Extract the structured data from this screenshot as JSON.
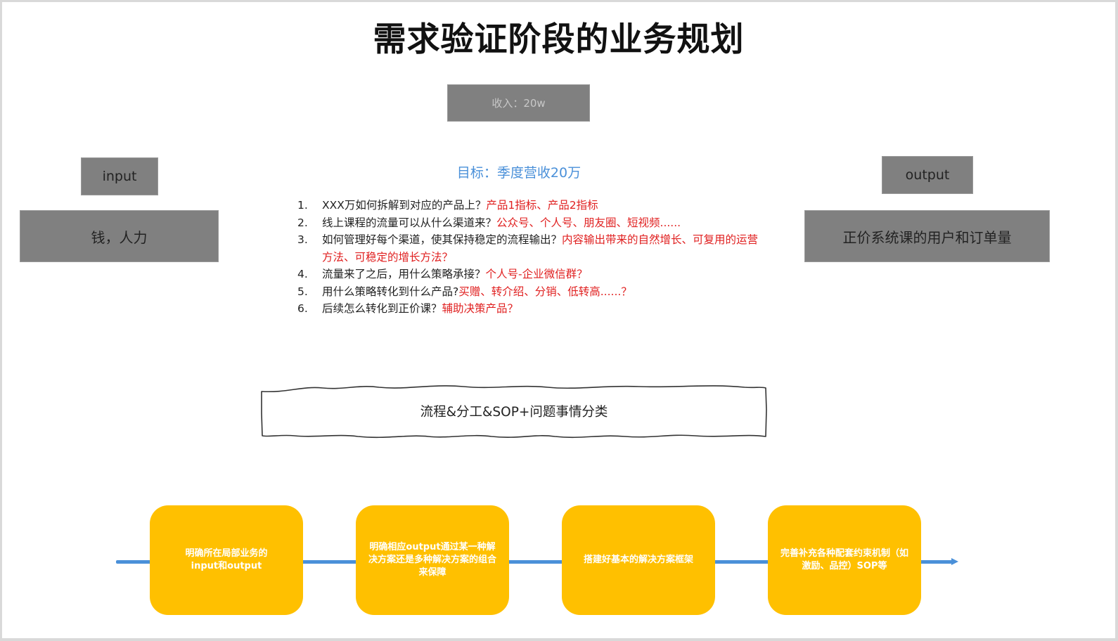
{
  "title": "需求验证阶段的业务规划",
  "revenue_box": "收入：20w",
  "input": {
    "label": "input",
    "value": "钱，人力"
  },
  "output": {
    "label": "output",
    "value": "正价系统课的用户和订单量"
  },
  "goal": "目标：季度营收20万",
  "questions": [
    {
      "num": "1.",
      "text": "XXX万如何拆解到对应的产品上？",
      "answer": "产品1指标、产品2指标"
    },
    {
      "num": "2.",
      "text": "线上课程的流量可以从什么渠道来？",
      "answer": "公众号、个人号、朋友圈、短视频......"
    },
    {
      "num": "3.",
      "text": "如何管理好每个渠道，使其保持稳定的流程输出？",
      "answer": "内容输出带来的自然增长、可复用的运营方法、可稳定的增长方法？"
    },
    {
      "num": "4.",
      "text": "流量来了之后，用什么策略承接？",
      "answer": "个人号-企业微信群？"
    },
    {
      "num": "5.",
      "text": "用什么策略转化到什么产品?",
      "answer": "买赠、转介绍、分销、低转高......？"
    },
    {
      "num": "6.",
      "text": "后续怎么转化到正价课？",
      "answer": "辅助决策产品？"
    }
  ],
  "process_box": "流程&分工&SOP+问题事情分类",
  "flow": {
    "line_color": "#4a90d9",
    "step_color": "#ffc000",
    "steps": [
      {
        "text": "明确所在局部业务的input和output"
      },
      {
        "text": "明确相应output通过某一种解决方案还是多种解决方案的组合来保障"
      },
      {
        "text": "搭建好基本的解决方案框架"
      },
      {
        "text": "完善补充各种配套约束机制（如激励、品控）SOP等"
      }
    ]
  },
  "colors": {
    "gray_box": "#808080",
    "goal_blue": "#4a90d9",
    "answer_red": "#e02020"
  }
}
